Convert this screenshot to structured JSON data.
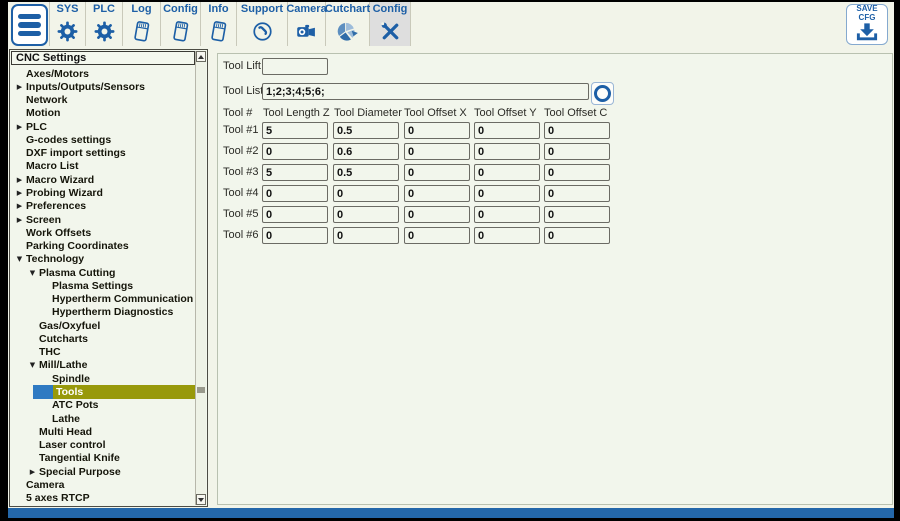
{
  "colors": {
    "accent_blue": "#1d5fa6",
    "toolbar_bg": "#f2f4e9",
    "panel_bg": "#f2f6ec",
    "active_tab_gray": "#dedede",
    "selected_item_olive": "#98990b",
    "selected_item_blue": "#2f7ac2",
    "bottom_bar_blue": "#2467a9"
  },
  "toolbar": {
    "items": [
      {
        "label": "SYS",
        "icon": "gear",
        "active": false
      },
      {
        "label": "PLC",
        "icon": "gear",
        "active": false
      },
      {
        "label": "Log",
        "icon": "page",
        "active": false
      },
      {
        "label": "Config",
        "icon": "page",
        "active": false
      },
      {
        "label": "Info",
        "icon": "page",
        "active": false
      },
      {
        "label": "Support",
        "icon": "dial",
        "active": false
      },
      {
        "label": "Camera",
        "icon": "camera",
        "active": false
      },
      {
        "label": "Cutchart",
        "icon": "pie",
        "active": false
      },
      {
        "label": "Config",
        "icon": "tools",
        "active": true
      }
    ],
    "save_button": {
      "line1": "SAVE",
      "line2": "CFG"
    }
  },
  "sidebar": {
    "header": "CNC Settings",
    "items": [
      {
        "label": "Axes/Motors",
        "level": 0,
        "arrow": "none",
        "selected": false
      },
      {
        "label": "Inputs/Outputs/Sensors",
        "level": 0,
        "arrow": "right",
        "selected": false
      },
      {
        "label": "Network",
        "level": 0,
        "arrow": "none",
        "selected": false
      },
      {
        "label": "Motion",
        "level": 0,
        "arrow": "none",
        "selected": false
      },
      {
        "label": "PLC",
        "level": 0,
        "arrow": "right",
        "selected": false
      },
      {
        "label": "G-codes settings",
        "level": 0,
        "arrow": "none",
        "selected": false
      },
      {
        "label": "DXF import settings",
        "level": 0,
        "arrow": "none",
        "selected": false
      },
      {
        "label": "Macro List",
        "level": 0,
        "arrow": "none",
        "selected": false
      },
      {
        "label": "Macro Wizard",
        "level": 0,
        "arrow": "right",
        "selected": false
      },
      {
        "label": "Probing Wizard",
        "level": 0,
        "arrow": "right",
        "selected": false
      },
      {
        "label": "Preferences",
        "level": 0,
        "arrow": "right",
        "selected": false
      },
      {
        "label": "Screen",
        "level": 0,
        "arrow": "right",
        "selected": false
      },
      {
        "label": "Work Offsets",
        "level": 0,
        "arrow": "none",
        "selected": false
      },
      {
        "label": "Parking Coordinates",
        "level": 0,
        "arrow": "none",
        "selected": false
      },
      {
        "label": "Technology",
        "level": 0,
        "arrow": "down",
        "selected": false
      },
      {
        "label": "Plasma Cutting",
        "level": 1,
        "arrow": "down",
        "selected": false
      },
      {
        "label": "Plasma Settings",
        "level": 2,
        "arrow": "none",
        "selected": false
      },
      {
        "label": "Hypertherm Communication",
        "level": 2,
        "arrow": "none",
        "selected": false
      },
      {
        "label": "Hypertherm Diagnostics",
        "level": 2,
        "arrow": "none",
        "selected": false
      },
      {
        "label": "Gas/Oxyfuel",
        "level": 1,
        "arrow": "none",
        "selected": false
      },
      {
        "label": "Cutcharts",
        "level": 1,
        "arrow": "none",
        "selected": false
      },
      {
        "label": "THC",
        "level": 1,
        "arrow": "none",
        "selected": false
      },
      {
        "label": "Mill/Lathe",
        "level": 1,
        "arrow": "down",
        "selected": false
      },
      {
        "label": "Spindle",
        "level": 2,
        "arrow": "none",
        "selected": false
      },
      {
        "label": "Tools",
        "level": 2,
        "arrow": "none",
        "selected": true
      },
      {
        "label": "ATC Pots",
        "level": 2,
        "arrow": "none",
        "selected": false
      },
      {
        "label": "Lathe",
        "level": 2,
        "arrow": "none",
        "selected": false
      },
      {
        "label": "Multi Head",
        "level": 1,
        "arrow": "none",
        "selected": false
      },
      {
        "label": "Laser control",
        "level": 1,
        "arrow": "none",
        "selected": false
      },
      {
        "label": "Tangential Knife",
        "level": 1,
        "arrow": "none",
        "selected": false
      },
      {
        "label": "Special Purpose",
        "level": 1,
        "arrow": "right",
        "selected": false
      },
      {
        "label": "Camera",
        "level": 0,
        "arrow": "none",
        "selected": false
      },
      {
        "label": "5 axes RTCP",
        "level": 0,
        "arrow": "none",
        "selected": false
      }
    ]
  },
  "main": {
    "tool_lift_label": "Tool Lift",
    "tool_lift_value": "",
    "tool_list_label": "Tool List",
    "tool_list_value": "1;2;3;4;5;6;",
    "table": {
      "headers": [
        "Tool #",
        "Tool Length Z",
        "Tool Diameter",
        "Tool Offset X",
        "Tool Offset Y",
        "Tool Offset C"
      ],
      "rows": [
        {
          "label": "Tool #1",
          "values": [
            "5",
            "0.5",
            "0",
            "0",
            "0"
          ]
        },
        {
          "label": "Tool #2",
          "values": [
            "0",
            "0.6",
            "0",
            "0",
            "0"
          ]
        },
        {
          "label": "Tool #3",
          "values": [
            "5",
            "0.5",
            "0",
            "0",
            "0"
          ]
        },
        {
          "label": "Tool #4",
          "values": [
            "0",
            "0",
            "0",
            "0",
            "0"
          ]
        },
        {
          "label": "Tool #5",
          "values": [
            "0",
            "0",
            "0",
            "0",
            "0"
          ]
        },
        {
          "label": "Tool #6",
          "values": [
            "0",
            "0",
            "0",
            "0",
            "0"
          ]
        }
      ]
    }
  }
}
